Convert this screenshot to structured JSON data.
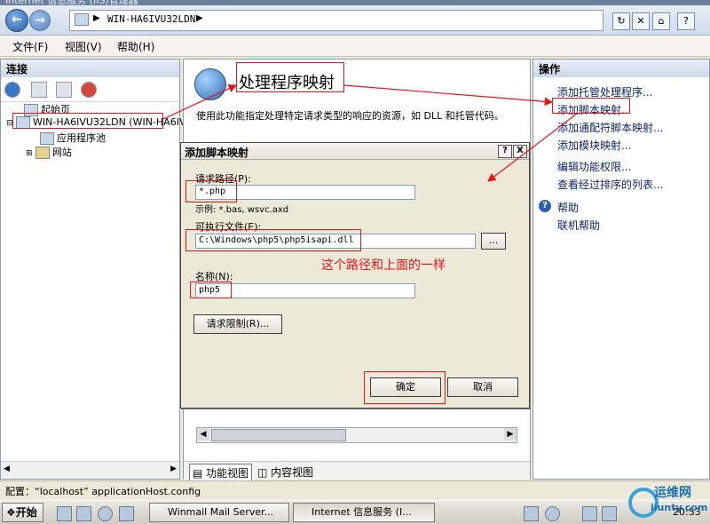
{
  "window": {
    "title": "Internet 信息服务 (IIS)管理器"
  },
  "address": {
    "path": "WIN-HA6IVU32LDN"
  },
  "menu": {
    "file": "文件(F)",
    "view": "视图(V)",
    "help": "帮助(H)"
  },
  "left": {
    "header": "连接",
    "tree": {
      "start_page": "起始页",
      "server": "WIN-HA6IVU32LDN (WIN-HA6IV",
      "app_pools": "应用程序池",
      "sites": "网站"
    }
  },
  "center": {
    "title": "处理程序映射",
    "description": "使用此功能指定处理特定请求类型的响应的资源，如 DLL 和托管代码。",
    "tabs": {
      "features": "功能视图",
      "content": "内容视图"
    }
  },
  "right": {
    "header": "操作",
    "actions": [
      "添加托管处理程序...",
      "添加脚本映射...",
      "添加通配符脚本映射...",
      "添加模块映射...",
      "编辑功能权限...",
      "查看经过排序的列表..."
    ],
    "help": "帮助",
    "online_help": "联机帮助"
  },
  "dialog": {
    "title": "添加脚本映射",
    "request_path_label": "请求路径(P):",
    "request_path_value": "*.php",
    "example": "示例: *.bas, wsvc.axd",
    "executable_label": "可执行文件(E):",
    "executable_value": "C:\\Windows\\php5\\php5isapi.dll",
    "browse": "...",
    "name_label": "名称(N):",
    "name_value": "php5",
    "restrictions_button": "请求限制(R)...",
    "ok": "确定",
    "cancel": "取消",
    "help_btn": "?",
    "close_btn": "X",
    "annotation": "这个路径和上面的一样"
  },
  "status": {
    "text": "配置：“localhost” applicationHost.config"
  },
  "taskbar": {
    "start": "开始",
    "tasks": [
      "Winmail Mail Server...",
      "Internet 信息服务 (I..."
    ],
    "clock": "20:53"
  },
  "watermark": {
    "line1": "运维网",
    "line2": "iiunty.com"
  },
  "colors": {
    "annotation_red": "#e8141b",
    "link_blue": "#0a246a"
  }
}
